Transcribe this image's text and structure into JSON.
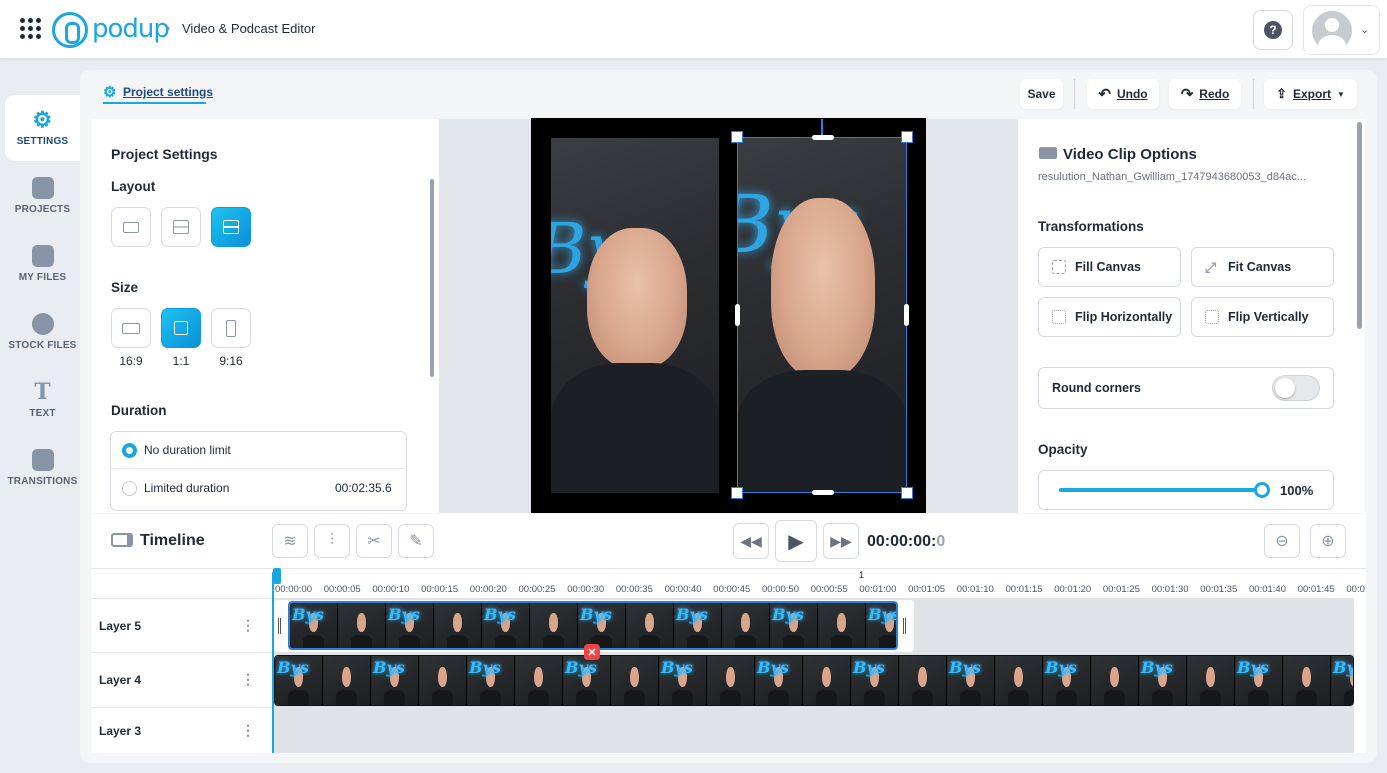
{
  "header": {
    "logo_text": "podup",
    "breadcrumb_separator": "›",
    "breadcrumb": "Video & Podcast Editor",
    "help_label": "?",
    "menu_caret": "⌄"
  },
  "sidebar": {
    "items": [
      {
        "label": "SETTINGS",
        "icon": "gear-icon",
        "active": true
      },
      {
        "label": "PROJECTS",
        "icon": "projects-icon"
      },
      {
        "label": "MY FILES",
        "icon": "files-icon"
      },
      {
        "label": "STOCK FILES",
        "icon": "cloud-icon"
      },
      {
        "label": "TEXT",
        "icon": "text-icon"
      },
      {
        "label": "TRANSITIONS",
        "icon": "transitions-icon"
      }
    ]
  },
  "toolbar": {
    "tab_label": "Project settings",
    "save_label": "Save",
    "undo_label": "Undo",
    "redo_label": "Redo",
    "export_label": "Export"
  },
  "project_settings": {
    "title": "Project Settings",
    "layout_label": "Layout",
    "size_label": "Size",
    "sizes": [
      "16:9",
      "1:1",
      "9:16"
    ],
    "selected_size": "1:1",
    "duration_label": "Duration",
    "duration_options": [
      {
        "label": "No duration limit",
        "selected": true
      },
      {
        "label": "Limited duration",
        "value": "00:02:35.6"
      }
    ]
  },
  "clip_options": {
    "title": "Video Clip Options",
    "filename": "resulution_Nathan_Gwilliam_1747943680053_d84ac...",
    "transformations_label": "Transformations",
    "buttons": [
      "Fill Canvas",
      "Fit Canvas",
      "Flip Horizontally",
      "Flip Vertically"
    ],
    "round_corners_label": "Round corners",
    "round_corners_on": false,
    "opacity_label": "Opacity",
    "opacity_value": "100%"
  },
  "timeline": {
    "title": "Timeline",
    "timecode": "00:00:00:",
    "timecode_frame": "0",
    "ruler_marker": "1",
    "ticks": [
      "00:00:00",
      "00:00:05",
      "00:00:10",
      "00:00:15",
      "00:00:20",
      "00:00:25",
      "00:00:30",
      "00:00:35",
      "00:00:40",
      "00:00:45",
      "00:00:50",
      "00:00:55",
      "00:01:00",
      "00:01:05",
      "00:01:10",
      "00:01:15",
      "00:01:20",
      "00:01:25",
      "00:01:30",
      "00:01:35",
      "00:01:40",
      "00:01:45",
      "00:0"
    ],
    "layers": [
      "Layer 5",
      "Layer 4",
      "Layer 3"
    ],
    "layer_menu": "⋮",
    "neon_glyph": "Bys",
    "remove_label": "✕"
  },
  "colors": {
    "accent": "#1aa7e0",
    "selection": "#2f7fd9",
    "danger": "#ef4444"
  }
}
